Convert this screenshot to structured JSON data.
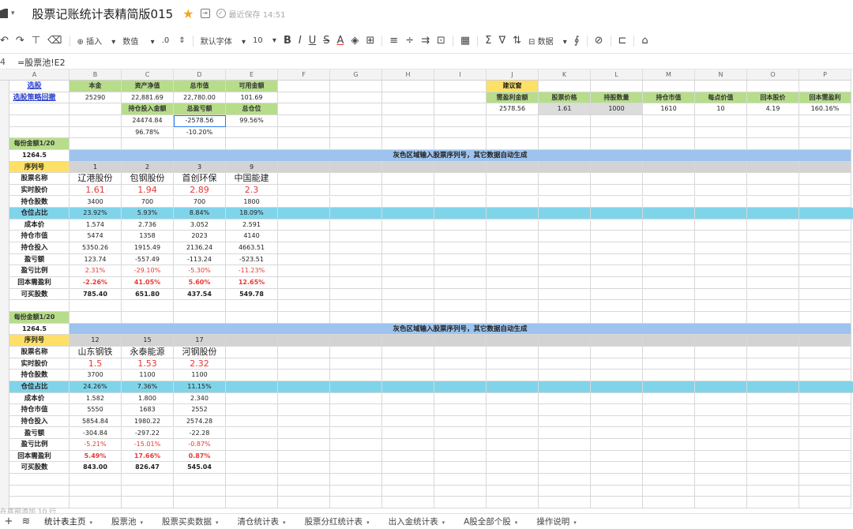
{
  "titlebar": {
    "doc_name": "股票记账统计表精简版015",
    "saved_text": "最近保存 14:51"
  },
  "toolbar": {
    "insert": "插入",
    "number_format": "数值",
    "decimal": ".0",
    "font": "默认字体",
    "font_size": "10",
    "data": "数据"
  },
  "formula": {
    "cell_ref": "4",
    "content": "=股票池!E2"
  },
  "columns": [
    "A",
    "B",
    "C",
    "D",
    "E",
    "F",
    "G",
    "H",
    "I",
    "J",
    "K",
    "L",
    "M",
    "N",
    "O",
    "P"
  ],
  "sheet_tabs": [
    "统计表主页",
    "股票池",
    "股票买卖数据",
    "清仓统计表",
    "股票分红统计表",
    "出入金统计表",
    "A股全部个股",
    "操作说明"
  ],
  "add_bar_text": "在底部添加 10 行",
  "colors": {
    "green_header": "#b7dd8a",
    "yellow_header": "#ffe066",
    "cyan_band": "#80d4ea",
    "blue_band": "#9dc3ee",
    "red_text": "#e53935",
    "link_blue": "#2a3fcc"
  },
  "cells": {
    "links": [
      "选股",
      "选股策略回撤"
    ],
    "top": {
      "benjin_label": "本金",
      "benjin_val": "25290",
      "zichan_label": "资产净值",
      "zichan_val": "22,881.69",
      "shizhi_label": "总市值",
      "shizhi_val": "22,780.00",
      "keyong_label": "可用金额",
      "keyong_val": "101.69",
      "chicang_label": "持仓投入金额",
      "chicang_val": "24474.84",
      "chicang_pct": "96.78%",
      "yingkui_label": "总盈亏额",
      "yingkui_val": "-2578.56",
      "yingkui_pct": "-10.20%",
      "cangwei_label": "总仓位",
      "cangwei_val": "99.56%"
    },
    "jianyi": {
      "title": "建议窗",
      "headers": [
        "需盈利金额",
        "股票价格",
        "持股数量",
        "持仓市值",
        "每点价值",
        "回本股价",
        "回本需盈利"
      ],
      "values": [
        "2578.56",
        "1.61",
        "1000",
        "1610",
        "10",
        "4.19",
        "160.16%"
      ]
    },
    "section_note": "灰色区域输入股票序列号，其它数据自动生成",
    "row_labels": [
      "序列号",
      "股票名称",
      "实时股价",
      "持仓股数",
      "仓位占比",
      "成本价",
      "持仓市值",
      "持仓投入",
      "盈亏额",
      "盈亏比例",
      "回本需盈利",
      "可买股数"
    ],
    "per_amount_label": "每份金额1/20",
    "per_amount_val": "1264.5",
    "block1": {
      "ids": [
        "1",
        "2",
        "3",
        "9"
      ],
      "names": [
        "辽港股份",
        "包钢股份",
        "首创环保",
        "中国能建"
      ],
      "prices": [
        "1.61",
        "1.94",
        "2.89",
        "2.3"
      ],
      "shares": [
        "3400",
        "700",
        "700",
        "1800"
      ],
      "ratios": [
        "23.92%",
        "5.93%",
        "8.84%",
        "18.09%"
      ],
      "costs": [
        "1.574",
        "2.736",
        "3.052",
        "2.591"
      ],
      "values": [
        "5474",
        "1358",
        "2023",
        "4140"
      ],
      "invested": [
        "5350.26",
        "1915.49",
        "2136.24",
        "4663.51"
      ],
      "pnl": [
        "123.74",
        "-557.49",
        "-113.24",
        "-523.51"
      ],
      "pnl_pct": [
        "2.31%",
        "-29.10%",
        "-5.30%",
        "-11.23%"
      ],
      "recover": [
        "-2.26%",
        "41.05%",
        "5.60%",
        "12.65%"
      ],
      "buyable": [
        "785.40",
        "651.80",
        "437.54",
        "549.78"
      ]
    },
    "block2": {
      "ids": [
        "12",
        "15",
        "17"
      ],
      "names": [
        "山东钢铁",
        "永泰能源",
        "河钢股份"
      ],
      "prices": [
        "1.5",
        "1.53",
        "2.32"
      ],
      "shares": [
        "3700",
        "1100",
        "1100"
      ],
      "ratios": [
        "24.26%",
        "7.36%",
        "11.15%"
      ],
      "costs": [
        "1.582",
        "1.800",
        "2.340"
      ],
      "values": [
        "5550",
        "1683",
        "2552"
      ],
      "invested": [
        "5854.84",
        "1980.22",
        "2574.28"
      ],
      "pnl": [
        "-304.84",
        "-297.22",
        "-22.28"
      ],
      "pnl_pct": [
        "-5.21%",
        "-15.01%",
        "-0.87%"
      ],
      "recover": [
        "5.49%",
        "17.66%",
        "0.87%"
      ],
      "buyable": [
        "843.00",
        "826.47",
        "545.04"
      ]
    }
  }
}
